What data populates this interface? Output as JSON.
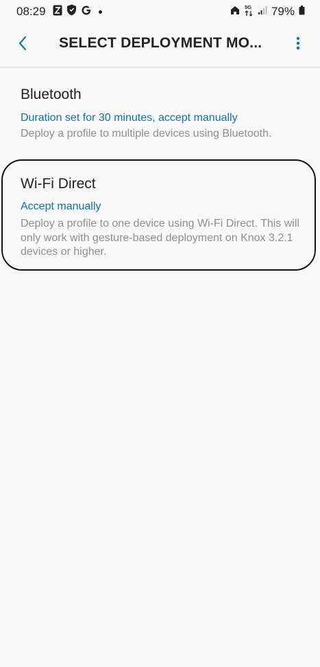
{
  "status_bar": {
    "time": "08:29",
    "battery_percent": "79%",
    "network": "5G",
    "notification_icons": [
      "nfc-tag-icon",
      "shield-icon",
      "google-g-icon",
      "dot-icon"
    ],
    "system_icons": [
      "home-signal-icon",
      "network-5g-icon",
      "signal-bars-icon",
      "battery-icon"
    ]
  },
  "app_bar": {
    "title": "SELECT DEPLOYMENT MO...",
    "back_icon": "chevron-left-icon",
    "more_icon": "more-vert-icon"
  },
  "options": [
    {
      "title": "Bluetooth",
      "subtitle": "Duration set for 30 minutes, accept manually",
      "description": "Deploy a profile to multiple devices using Bluetooth."
    },
    {
      "title": "Wi-Fi Direct",
      "subtitle": "Accept manually",
      "description": "Deploy a profile to one device using Wi-Fi Direct. This will only work with gesture-based deployment on Knox 3.2.1 devices or higher."
    }
  ],
  "colors": {
    "accent": "#0f73a5",
    "background": "#f8f8f8",
    "description": "#8e8e8e",
    "highlight_border": "#111111"
  }
}
